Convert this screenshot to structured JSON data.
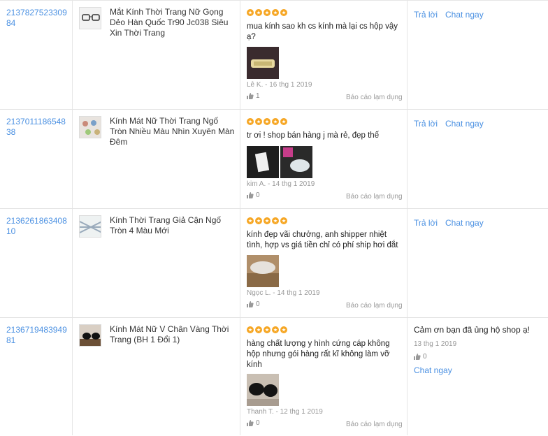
{
  "reviews": [
    {
      "order_id": "213782752330984",
      "product_name": "Mắt Kính Thời Trang Nữ Gọng Dẻo Hàn Quốc Tr90 Jc038 Siêu Xin Thời Trang",
      "rating": 5,
      "comment": "mua kính sao kh cs kính mà lại cs hộp vậy ạ?",
      "author_date": "Lê K. - 16 thg 1 2019",
      "likes": "1",
      "report": "Báo cáo lạm dụng",
      "reply_label": "Trả lời",
      "chat_label": "Chat ngay"
    },
    {
      "order_id": "213701118654838",
      "product_name": "Kính Mát Nữ Thời Trang Ngố Tròn Nhiều Màu Nhìn Xuyên Màn Đêm",
      "rating": 5,
      "comment": "tr ơi ! shop bán hàng j mà rẻ, đẹp thế",
      "author_date": "kim A. - 14 thg 1 2019",
      "likes": "0",
      "report": "Báo cáo lạm dụng",
      "reply_label": "Trả lời",
      "chat_label": "Chat ngay"
    },
    {
      "order_id": "213626186340810",
      "product_name": "Kính Thời Trang Giả Cận Ngố Tròn 4 Màu Mới",
      "rating": 5,
      "comment": "kính đẹp vãi chưởng, anh shipper nhiệt tình, hợp vs giá tiền chỉ có phí ship hơi đắt",
      "author_date": "Ngọc L. - 14 thg 1 2019",
      "likes": "0",
      "report": "Báo cáo lạm dụng",
      "reply_label": "Trả lời",
      "chat_label": "Chat ngay"
    },
    {
      "order_id": "213671948394981",
      "product_name": "Kính Mát Nữ V Chân Vàng Thời Trang (BH 1 Đổi 1)",
      "rating": 5,
      "comment": "hàng chất lượng y hình cứng cáp không hộp nhưng gói hàng rất kĩ không làm vỡ kính",
      "author_date": "Thanh T. - 12 thg 1 2019",
      "likes": "0",
      "report": "Báo cáo lạm dụng",
      "shop_reply": {
        "text": "Cảm ơn bạn đã ủng hộ shop ạ!",
        "date": "13 thg 1 2019",
        "likes": "0"
      },
      "chat_label": "Chat ngay"
    }
  ],
  "colors": {
    "link": "#4a90e2",
    "star": "#f6a623",
    "border": "#e3e3e3",
    "muted": "#999999"
  },
  "icons": [
    "star-icon",
    "thumbs-up-icon"
  ]
}
